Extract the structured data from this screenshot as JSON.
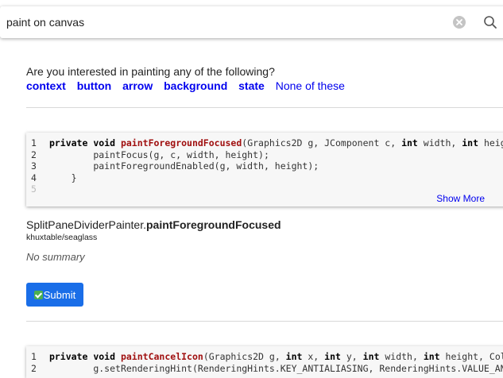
{
  "search": {
    "value": "paint on canvas"
  },
  "prompt": {
    "question": "Are you interested in painting any of the following?",
    "options": [
      "context",
      "button",
      "arrow",
      "background",
      "state"
    ],
    "none_label": "None of these"
  },
  "results": [
    {
      "lines": [
        {
          "num": "1",
          "parts": [
            {
              "t": "private void ",
              "c": "kw"
            },
            {
              "t": "paintForegroundFocused",
              "c": "fn"
            },
            {
              "t": "(Graphics2D g, JComponent c, ",
              "c": ""
            },
            {
              "t": "int",
              "c": "kw"
            },
            {
              "t": " width, ",
              "c": ""
            },
            {
              "t": "int",
              "c": "kw"
            },
            {
              "t": " height",
              "c": ""
            }
          ]
        },
        {
          "num": "2",
          "parts": [
            {
              "t": "        paintFocus(g, c, width, height);",
              "c": ""
            }
          ]
        },
        {
          "num": "3",
          "parts": [
            {
              "t": "        paintForegroundEnabled(g, width, height);",
              "c": ""
            }
          ]
        },
        {
          "num": "4",
          "parts": [
            {
              "t": "    }",
              "c": ""
            }
          ]
        },
        {
          "num": "5",
          "parts": []
        }
      ],
      "show_more": "Show More",
      "class_name": "SplitPaneDividerPainter.",
      "method_name": "paintForegroundFocused",
      "repo": "khuxtable/seaglass",
      "summary": "No summary",
      "submit_label": "Submit"
    },
    {
      "lines": [
        {
          "num": "1",
          "parts": [
            {
              "t": "private void ",
              "c": "kw"
            },
            {
              "t": "paintCancelIcon",
              "c": "fn"
            },
            {
              "t": "(Graphics2D g, ",
              "c": ""
            },
            {
              "t": "int",
              "c": "kw"
            },
            {
              "t": " x, ",
              "c": ""
            },
            {
              "t": "int",
              "c": "kw"
            },
            {
              "t": " y, ",
              "c": ""
            },
            {
              "t": "int",
              "c": "kw"
            },
            {
              "t": " width, ",
              "c": ""
            },
            {
              "t": "int",
              "c": "kw"
            },
            {
              "t": " height, Colo",
              "c": ""
            }
          ]
        },
        {
          "num": "2",
          "parts": [
            {
              "t": "        g.setRenderingHint(RenderingHints.KEY_ANTIALIASING, RenderingHints.VALUE_ANT",
              "c": ""
            }
          ]
        }
      ]
    }
  ]
}
